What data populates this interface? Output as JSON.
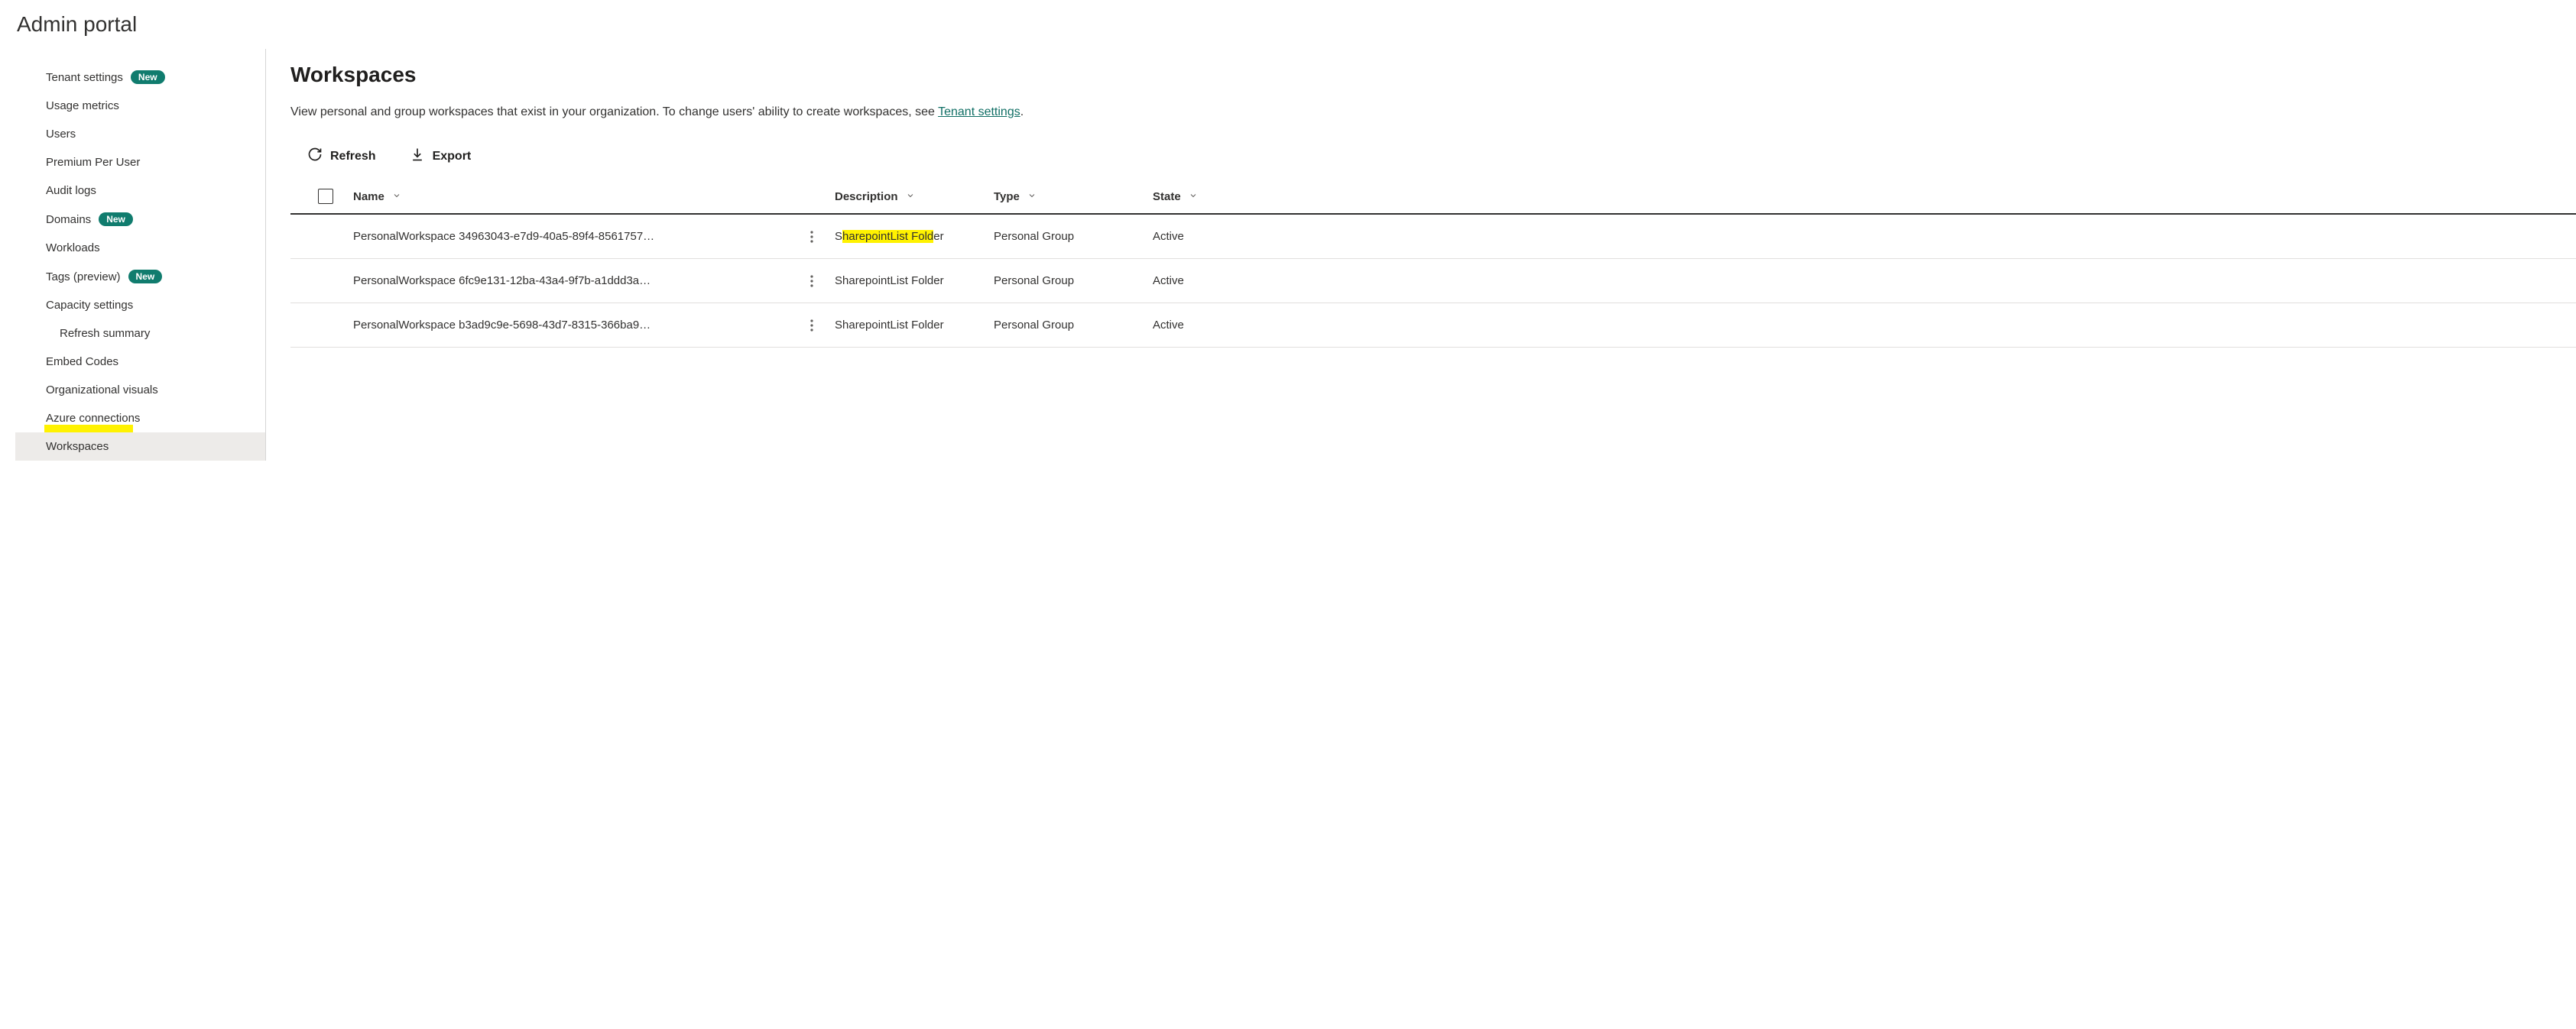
{
  "header": {
    "title": "Admin portal"
  },
  "sidebar": {
    "items": [
      {
        "label": "Tenant settings",
        "badge": "New",
        "sub": false
      },
      {
        "label": "Usage metrics",
        "badge": null,
        "sub": false
      },
      {
        "label": "Users",
        "badge": null,
        "sub": false
      },
      {
        "label": "Premium Per User",
        "badge": null,
        "sub": false
      },
      {
        "label": "Audit logs",
        "badge": null,
        "sub": false
      },
      {
        "label": "Domains",
        "badge": "New",
        "sub": false
      },
      {
        "label": "Workloads",
        "badge": null,
        "sub": false
      },
      {
        "label": "Tags (preview)",
        "badge": "New",
        "sub": false
      },
      {
        "label": "Capacity settings",
        "badge": null,
        "sub": false
      },
      {
        "label": "Refresh summary",
        "badge": null,
        "sub": true
      },
      {
        "label": "Embed Codes",
        "badge": null,
        "sub": false
      },
      {
        "label": "Organizational visuals",
        "badge": null,
        "sub": false
      },
      {
        "label": "Azure connections",
        "badge": null,
        "sub": false
      },
      {
        "label": "Workspaces",
        "badge": null,
        "sub": false,
        "selected": true,
        "highlighted": true
      }
    ]
  },
  "main": {
    "title": "Workspaces",
    "description_prefix": "View personal and group workspaces that exist in your organization. To change users' ability to create workspaces, see ",
    "description_link": "Tenant settings",
    "description_suffix": ".",
    "toolbar": {
      "refresh": "Refresh",
      "export": "Export"
    },
    "columns": {
      "name": "Name",
      "description": "Description",
      "type": "Type",
      "state": "State"
    },
    "rows": [
      {
        "name": "PersonalWorkspace 34963043-e7d9-40a5-89f4-8561757…",
        "description": "SharepointList Folder",
        "desc_highlight": true,
        "type": "Personal Group",
        "state": "Active"
      },
      {
        "name": "PersonalWorkspace 6fc9e131-12ba-43a4-9f7b-a1ddd3a…",
        "description": "SharepointList Folder",
        "desc_highlight": false,
        "type": "Personal Group",
        "state": "Active"
      },
      {
        "name": "PersonalWorkspace b3ad9c9e-5698-43d7-8315-366ba9…",
        "description": "SharepointList Folder",
        "desc_highlight": false,
        "type": "Personal Group",
        "state": "Active"
      }
    ]
  }
}
